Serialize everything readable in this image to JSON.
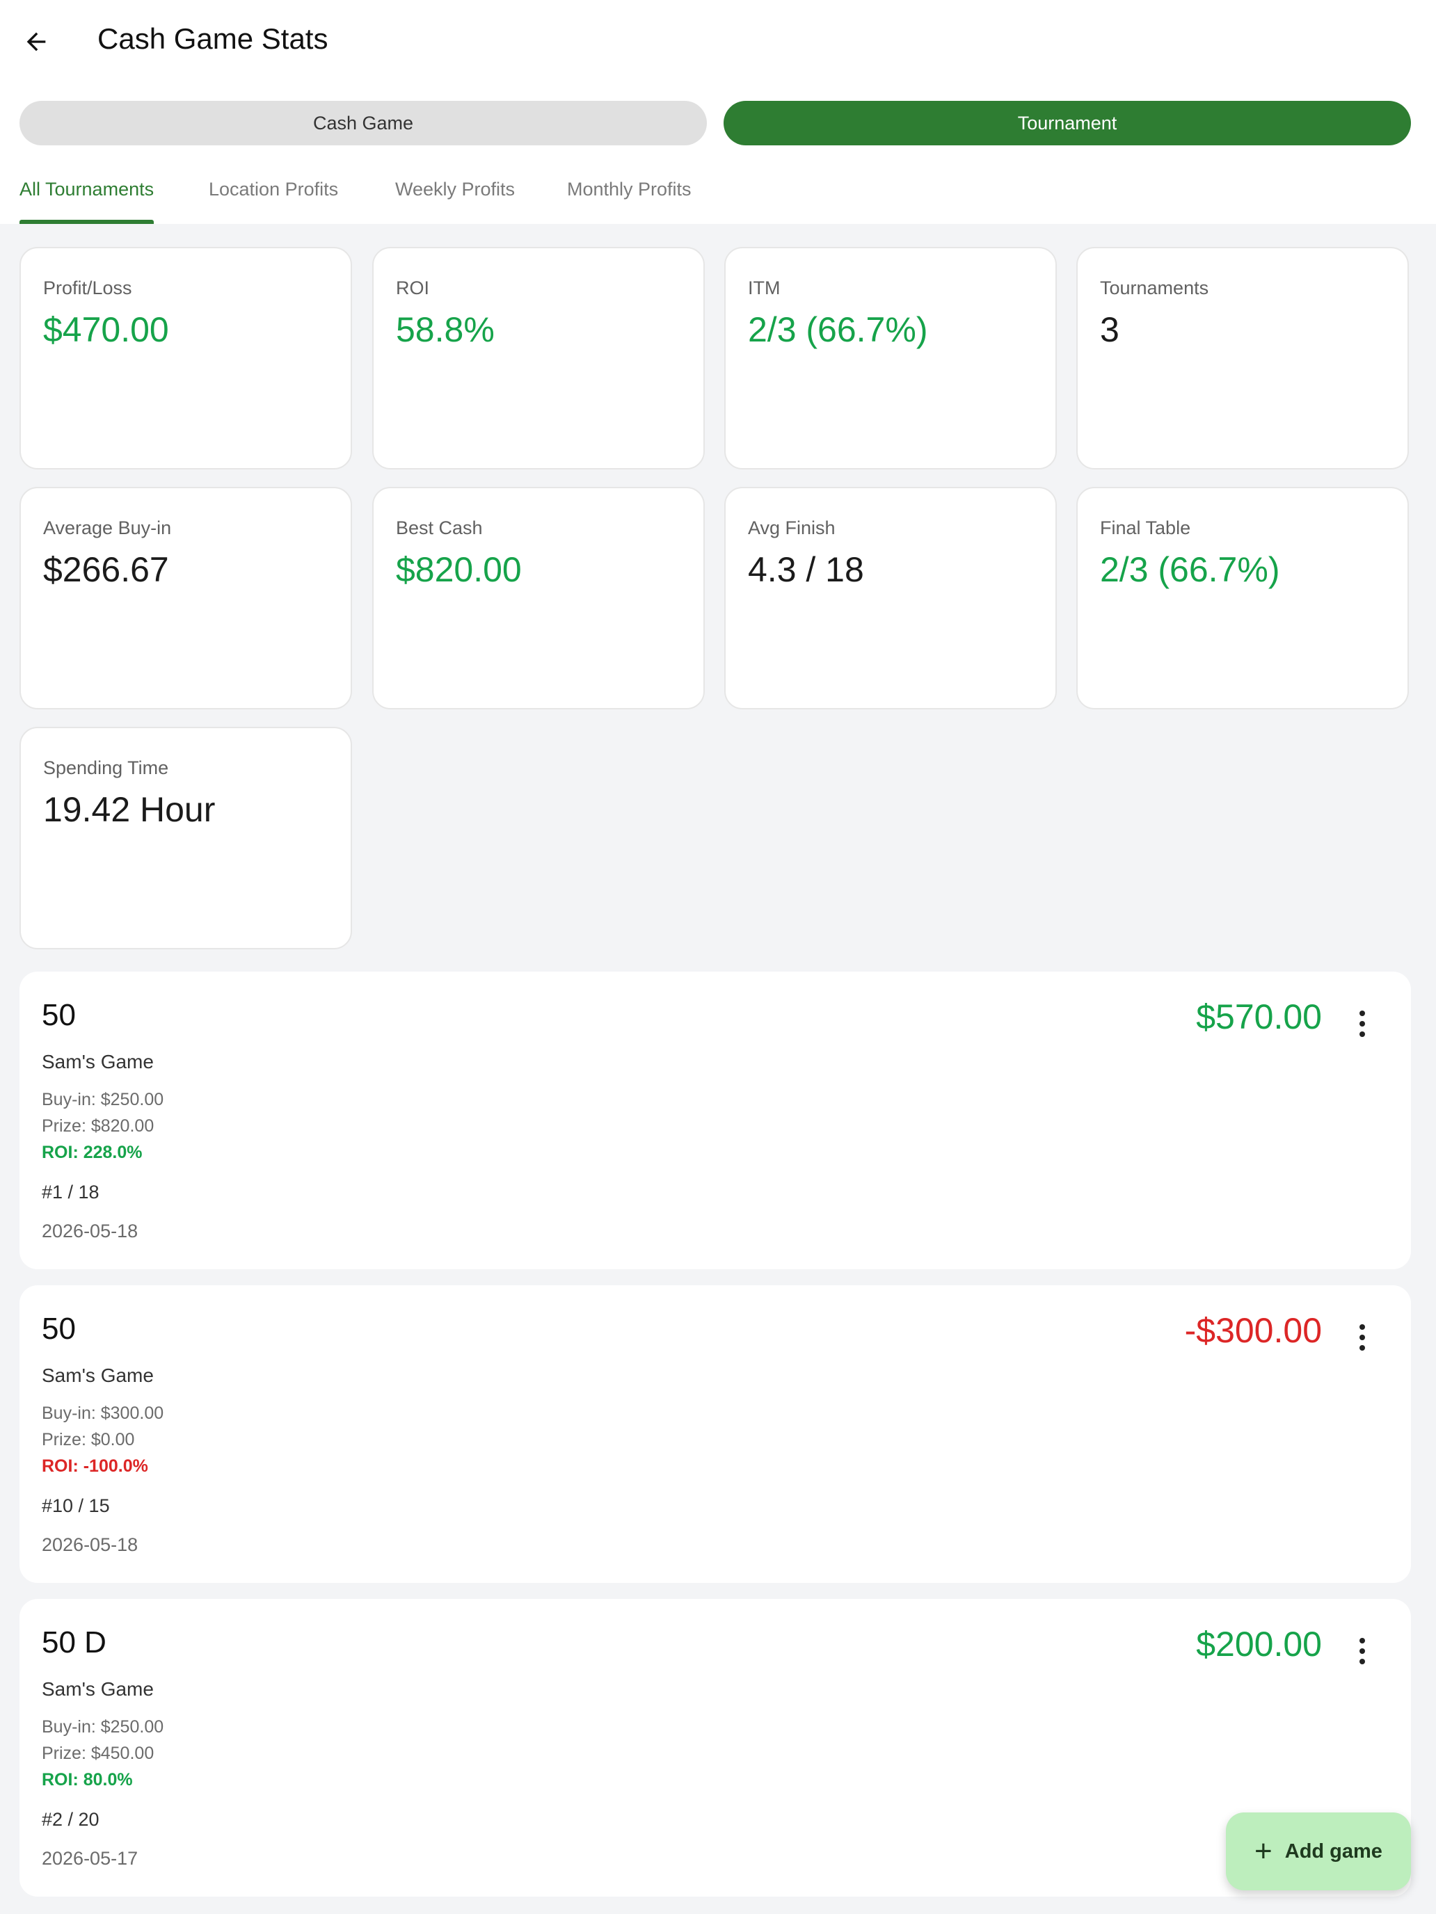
{
  "header": {
    "title": "Cash Game Stats",
    "back_icon": "arrow-left-icon"
  },
  "segments": {
    "cash_game": "Cash Game",
    "tournament": "Tournament",
    "selected": "Tournament"
  },
  "tabs": [
    {
      "label": "All Tournaments",
      "active": true
    },
    {
      "label": "Location Profits",
      "active": false
    },
    {
      "label": "Weekly Profits",
      "active": false
    },
    {
      "label": "Monthly Profits",
      "active": false
    }
  ],
  "stats": [
    {
      "label": "Profit/Loss",
      "value": "$470.00",
      "tone": "green"
    },
    {
      "label": "ROI",
      "value": "58.8%",
      "tone": "green"
    },
    {
      "label": "ITM",
      "value": "2/3 (66.7%)",
      "tone": "green"
    },
    {
      "label": "Tournaments",
      "value": "3",
      "tone": "dark"
    },
    {
      "label": "Average Buy-in",
      "value": "$266.67",
      "tone": "dark"
    },
    {
      "label": "Best Cash",
      "value": "$820.00",
      "tone": "green"
    },
    {
      "label": "Avg Finish",
      "value": "4.3 / 18",
      "tone": "dark"
    },
    {
      "label": "Final Table",
      "value": "2/3 (66.7%)",
      "tone": "green"
    },
    {
      "label": "Spending Time",
      "value": "19.42 Hour",
      "tone": "dark"
    }
  ],
  "games": [
    {
      "name": "50",
      "location": "Sam's Game",
      "buy_in": "Buy-in: $250.00",
      "prize": "Prize: $820.00",
      "roi": "ROI: 228.0%",
      "position": "#1 / 18",
      "date": "2026-05-18",
      "profit": "$570.00",
      "tone": "green"
    },
    {
      "name": "50",
      "location": "Sam's Game",
      "buy_in": "Buy-in: $300.00",
      "prize": "Prize: $0.00",
      "roi": "ROI: -100.0%",
      "position": "#10 / 15",
      "date": "2026-05-18",
      "profit": "-$300.00",
      "tone": "red"
    },
    {
      "name": "50 D",
      "location": "Sam's Game",
      "buy_in": "Buy-in: $250.00",
      "prize": "Prize: $450.00",
      "roi": "ROI: 80.0%",
      "position": "#2 / 20",
      "date": "2026-05-17",
      "profit": "$200.00",
      "tone": "green"
    }
  ],
  "fab": {
    "label": "Add game",
    "icon": "plus-icon"
  },
  "colors": {
    "primary_green": "#2e7d32",
    "positive": "#16a34a",
    "negative": "#dc2626",
    "fab_bg": "#bdeebd"
  }
}
